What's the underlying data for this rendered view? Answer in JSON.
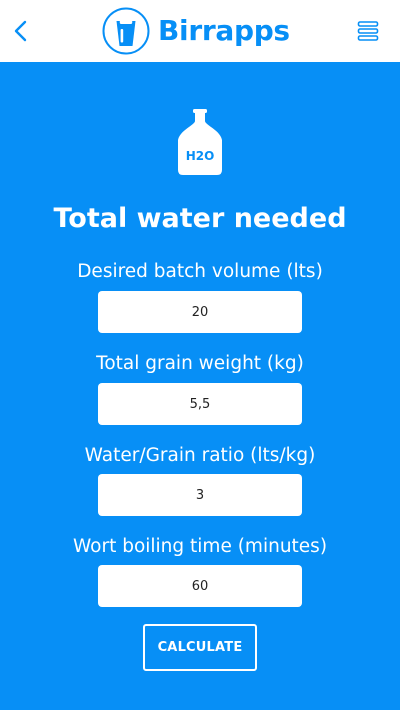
{
  "header": {
    "brand": "Birrapps",
    "back_icon": "chevron-left-icon",
    "menu_icon": "hamburger-menu-icon"
  },
  "hero": {
    "icon": "water-jug-icon",
    "icon_label": "H2O"
  },
  "page": {
    "title": "Total water needed"
  },
  "form": {
    "batch_volume": {
      "label": "Desired batch volume (lts)",
      "value": "20"
    },
    "grain_weight": {
      "label": "Total grain weight (kg)",
      "value": "5,5"
    },
    "ratio": {
      "label": "Water/Grain ratio (lts/kg)",
      "value": "3"
    },
    "boil_time": {
      "label": "Wort boiling time (minutes)",
      "value": "60"
    },
    "submit_label": "CALCULATE"
  },
  "colors": {
    "brand_blue": "#078ff6",
    "white": "#ffffff"
  }
}
